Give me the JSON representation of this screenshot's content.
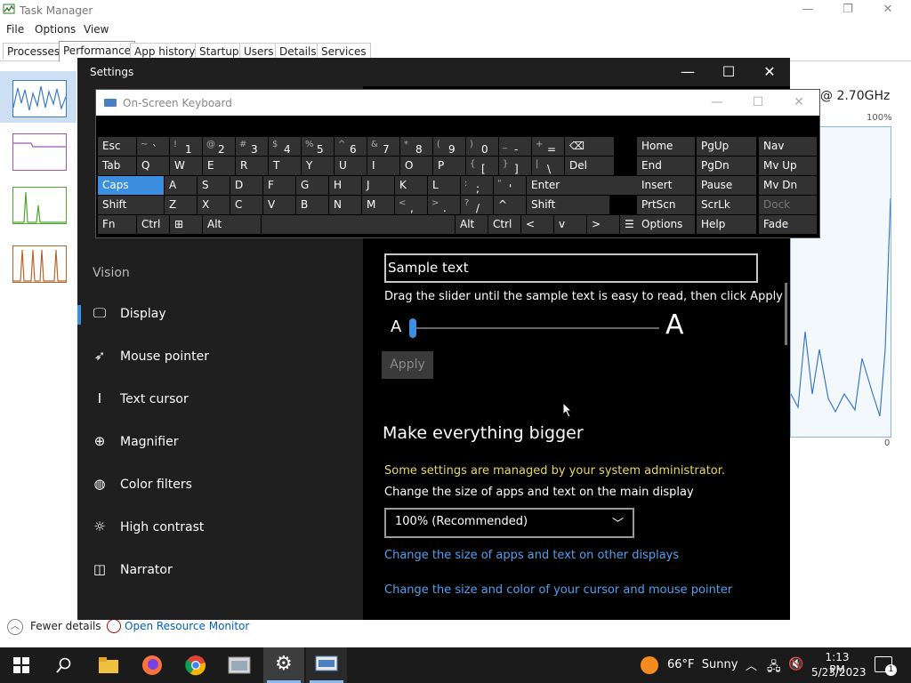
{
  "task_manager": {
    "title": "Task Manager",
    "menu": [
      "File",
      "Options",
      "View"
    ],
    "tabs": [
      "Processes",
      "Performance",
      "App history",
      "Startup",
      "Users",
      "Details",
      "Services"
    ],
    "active_tab": "Performance",
    "cpu_speed_fragment": "@ 2.70GHz",
    "graph_max_label": "100%",
    "graph_min_label": "0",
    "footer": {
      "fewer_details": "Fewer details",
      "open_resource_monitor": "Open Resource Monitor"
    }
  },
  "settings": {
    "title": "Settings",
    "section_label": "Vision",
    "nav": [
      "Display",
      "Mouse pointer",
      "Text cursor",
      "Magnifier",
      "Color filters",
      "High contrast",
      "Narrator"
    ],
    "selected_nav": "Display",
    "sample_text": "Sample text",
    "drag_hint": "Drag the slider until the sample text is easy to read, then click Apply",
    "slider": {
      "small_label": "A",
      "large_label": "A",
      "level_percent": 0
    },
    "apply_label": "Apply",
    "bigger_heading": "Make everything bigger",
    "managed_msg": "Some settings are managed by your system administrator.",
    "size_label": "Change the size of apps and text on the main display",
    "size_value": "100% (Recommended)",
    "link_other_displays": "Change the size of apps and text on other displays",
    "link_cursor": "Change the size and color of your cursor and mouse pointer"
  },
  "osk": {
    "title": "On-Screen Keyboard",
    "rows": [
      [
        {
          "m": "Esc"
        },
        {
          "s": "~",
          "m": "`"
        },
        {
          "s": "!",
          "m": "1"
        },
        {
          "s": "@",
          "m": "2"
        },
        {
          "s": "#",
          "m": "3"
        },
        {
          "s": "$",
          "m": "4"
        },
        {
          "s": "%",
          "m": "5"
        },
        {
          "s": "^",
          "m": "6"
        },
        {
          "s": "&",
          "m": "7"
        },
        {
          "s": "*",
          "m": "8"
        },
        {
          "s": "(",
          "m": "9"
        },
        {
          "s": ")",
          "m": "0"
        },
        {
          "s": "_",
          "m": "-"
        },
        {
          "s": "+",
          "m": "="
        },
        {
          "m": "⌫"
        }
      ],
      [
        {
          "m": "Tab"
        },
        {
          "m": "Q"
        },
        {
          "m": "W"
        },
        {
          "m": "E"
        },
        {
          "m": "R"
        },
        {
          "m": "T"
        },
        {
          "m": "Y"
        },
        {
          "m": "U"
        },
        {
          "m": "I"
        },
        {
          "m": "O"
        },
        {
          "m": "P"
        },
        {
          "s": "{",
          "m": "["
        },
        {
          "s": "}",
          "m": "]"
        },
        {
          "s": "|",
          "m": "\\"
        },
        {
          "m": "Del"
        }
      ],
      [
        {
          "m": "Caps"
        },
        {
          "m": "A"
        },
        {
          "m": "S"
        },
        {
          "m": "D"
        },
        {
          "m": "F"
        },
        {
          "m": "G"
        },
        {
          "m": "H"
        },
        {
          "m": "J"
        },
        {
          "m": "K"
        },
        {
          "m": "L"
        },
        {
          "s": ":",
          "m": ";"
        },
        {
          "s": "\"",
          "m": "'"
        },
        {
          "m": "Enter"
        }
      ],
      [
        {
          "m": "Shift"
        },
        {
          "m": "Z"
        },
        {
          "m": "X"
        },
        {
          "m": "C"
        },
        {
          "m": "V"
        },
        {
          "m": "B"
        },
        {
          "m": "N"
        },
        {
          "m": "M"
        },
        {
          "s": "<",
          "m": ","
        },
        {
          "s": ">",
          "m": "."
        },
        {
          "s": "?",
          "m": "/"
        },
        {
          "m": "^"
        },
        {
          "m": "Shift"
        }
      ],
      [
        {
          "m": "Fn"
        },
        {
          "m": "Ctrl"
        },
        {
          "m": "⊞"
        },
        {
          "m": "Alt"
        },
        {
          "m": ""
        },
        {
          "m": "Alt"
        },
        {
          "m": "Ctrl"
        },
        {
          "m": "<"
        },
        {
          "m": "v"
        },
        {
          "m": ">"
        },
        {
          "m": "☰"
        }
      ]
    ],
    "nav_keys": [
      [
        "Home",
        "PgUp",
        "Nav"
      ],
      [
        "End",
        "PgDn",
        "Mv Up"
      ],
      [
        "Insert",
        "Pause",
        "Mv Dn"
      ],
      [
        "PrtScn",
        "ScrLk",
        "Dock"
      ],
      [
        "Options",
        "Help",
        "Fade"
      ]
    ]
  },
  "taskbar": {
    "weather": "66°F  Sunny",
    "time": "1:13 PM",
    "date": "5/23/2023",
    "notification_count": "1"
  },
  "colors": {
    "accent": "#3c8fe0",
    "warning": "#e6d85c",
    "link": "#4ea1f3"
  }
}
